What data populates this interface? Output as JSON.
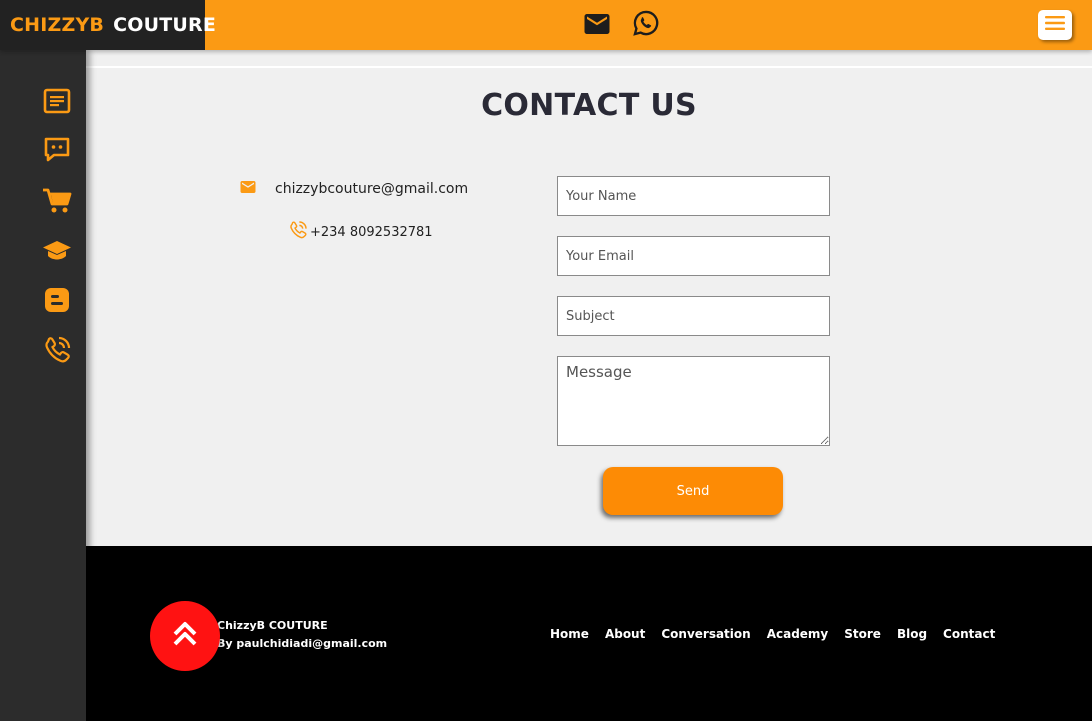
{
  "brand": {
    "part1": "CHIZZYB",
    "part2": "COUTURE"
  },
  "colors": {
    "accent": "#fb9a14",
    "sidebar": "#2c2c2c",
    "footer": "#000000",
    "scroll_top": "#ff1212"
  },
  "header": {
    "icons": [
      "mail-icon",
      "whatsapp-icon",
      "menu-icon"
    ]
  },
  "sidebar": {
    "icons": [
      "article-icon",
      "chat-icon",
      "cart-icon",
      "academy-icon",
      "blogger-icon",
      "phone-icon"
    ]
  },
  "main": {
    "title": "CONTACT US",
    "email": "chizzybcouture@gmail.com",
    "phone": "+234 8092532781",
    "form": {
      "name_placeholder": "Your Name",
      "email_placeholder": "Your Email",
      "subject_placeholder": "Subject",
      "message_placeholder": "Message",
      "send_label": "Send"
    }
  },
  "footer": {
    "brand": "ChizzyB COUTURE",
    "credit": "By paulchidiadi@gmail.com",
    "nav": [
      "Home",
      "About",
      "Conversation",
      "Academy",
      "Store",
      "Blog",
      "Contact"
    ]
  }
}
